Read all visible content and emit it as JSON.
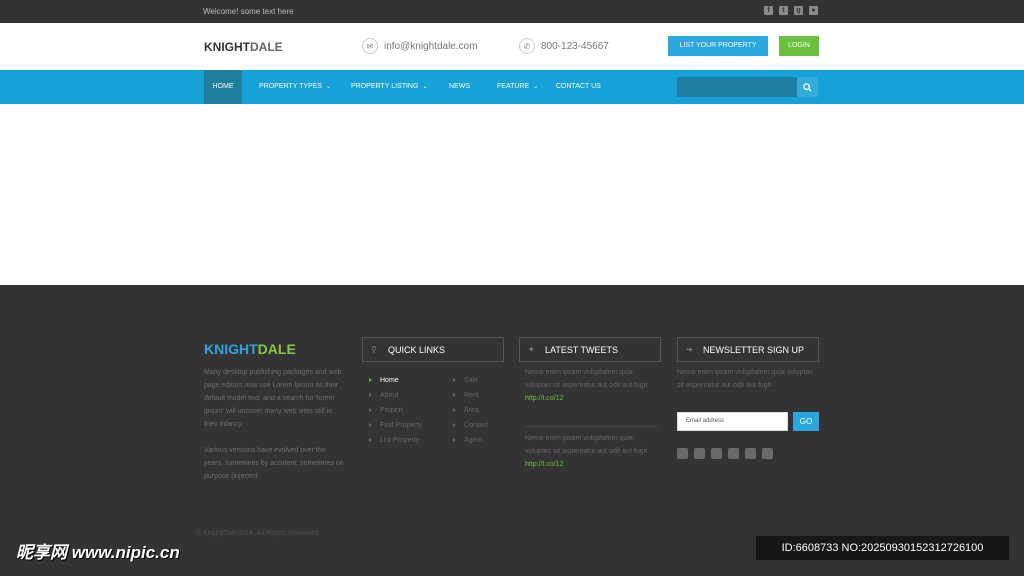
{
  "topbar": {
    "welcome": "Welcome! some text here",
    "social_icons": [
      "facebook-icon",
      "twitter-icon",
      "google-plus-icon",
      "flickr-icon"
    ]
  },
  "header": {
    "logo_part1": "KNIGHT",
    "logo_part2": "DALE",
    "email": "info@knightdale.com",
    "phone": "800-123-45667",
    "list_property_label": "LIST YOUR PROPERTY",
    "login_label": "LOGIN"
  },
  "nav": {
    "items": [
      {
        "label": "HOME",
        "active": true
      },
      {
        "label": "PROPERTY TYPES",
        "dropdown": true
      },
      {
        "label": "PROPERTY LISTING",
        "dropdown": true
      },
      {
        "label": "NEWS"
      },
      {
        "label": "FEATURE",
        "dropdown": true
      },
      {
        "label": "CONTACT US"
      }
    ]
  },
  "footer": {
    "logo_part1": "KNIGHT",
    "logo_part2": "DALE",
    "desc1": "Many desktop publishing packages and web page editors now use Lorem Ipsum as their default model text, and a search for 'lorem ipsum' will uncover many web sites still in their infancy.",
    "desc2": "Various versions have evolved over the years, sometimes by accident, sometimes on purpose (injected",
    "quick_links_title": "QUICK LINKS",
    "links_col1": [
      "Home",
      "About",
      "Propert",
      "Find Property",
      "List Property"
    ],
    "links_col2": [
      "Sale",
      "Rent",
      "Area",
      "Contact",
      "Agent"
    ],
    "tweets_title": "LATEST TWEETS",
    "tweets": [
      {
        "text": "Nemo enim ipsam voluptatem quia voluptas sit aspernatur aut odit aut fugit",
        "link": "http://t.co/12"
      },
      {
        "text": "Nemo enim ipsam voluptatem quia voluptas sit aspernatur aut odit aut fugit",
        "link": "http://t.co/12"
      }
    ],
    "newsletter_title": "NEWSLETTER SIGN UP",
    "newsletter_text": "Nemo enim ipsam voluptatem quia voluptas sit aspernatur aut odit aut fugit",
    "email_placeholder": "Email address",
    "go_label": "GO",
    "social_icons": [
      "twitter-icon",
      "facebook-icon",
      "linkedin-icon",
      "rss-icon",
      "youtube-icon",
      "flickr-icon"
    ],
    "copyright": "© KnightDale2014. All Rights Reserved."
  },
  "watermark": {
    "left": "昵享网 www.nipic.cn",
    "right": "ID:6608733 NO:20250930152312726100"
  },
  "colors": {
    "nav_bg": "#16a2d8",
    "nav_active": "#1f7f9c",
    "dark_bg": "#333333",
    "green": "#6cbf3f",
    "blue": "#29a6dd"
  }
}
